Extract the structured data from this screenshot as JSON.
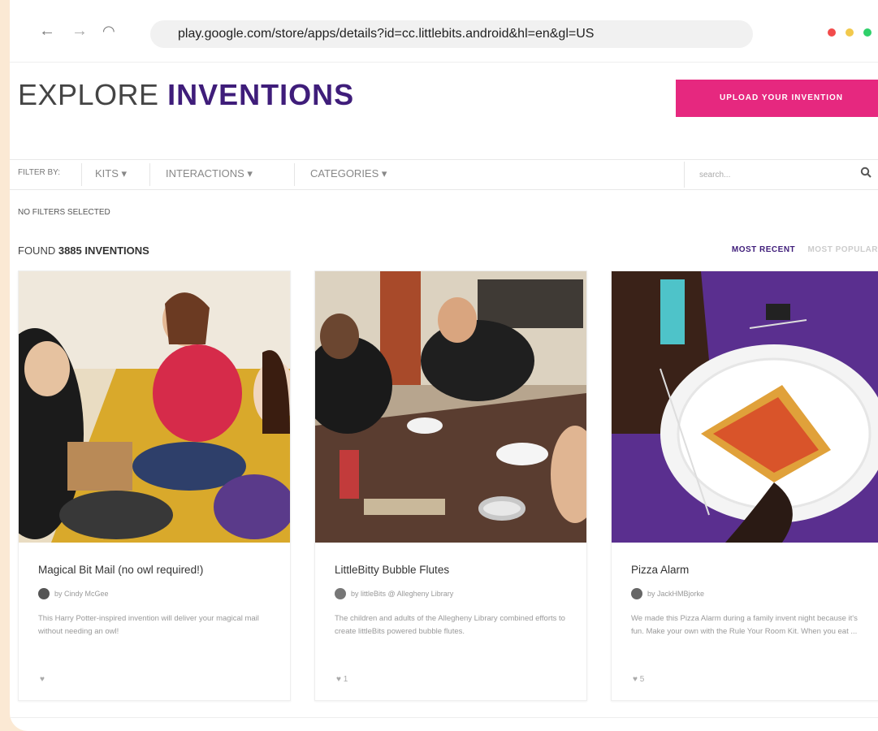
{
  "browser": {
    "url": "play.google.com/store/apps/details?id=cc.littlebits.android&hl=en&gl=US",
    "back_icon": "←",
    "forward_icon": "→",
    "reload_icon": "◠",
    "dot_colors": [
      "#f24b4b",
      "#f2c94c",
      "#2fd06a"
    ]
  },
  "header": {
    "title_light": "EXPLORE",
    "title_bold": "INVENTIONS",
    "upload_label": "UPLOAD YOUR INVENTION",
    "accent": "#e6287f",
    "brand_purple": "#3f1d7a"
  },
  "filters": {
    "label": "FILTER BY:",
    "items": [
      {
        "label": "KITS ▾"
      },
      {
        "label": "INTERACTIONS ▾"
      },
      {
        "label": "CATEGORIES ▾"
      }
    ],
    "search_placeholder": "search...",
    "no_filters": "NO FILTERS SELECTED"
  },
  "results": {
    "found_prefix": "FOUND",
    "count": "3885",
    "found_suffix": "INVENTIONS",
    "sort_active": "MOST RECENT",
    "sort_inactive": "MOST POPULAR"
  },
  "cards": [
    {
      "title": "Magical Bit Mail (no owl required!)",
      "author": "by Cindy McGee",
      "desc": "This Harry Potter-inspired invention will deliver your magical mail without needing an owl!",
      "likes": "♥"
    },
    {
      "title": "LittleBitty Bubble Flutes",
      "author": "by littleBits @ Allegheny Library",
      "desc": "The children and adults of the Allegheny Library combined efforts to create littleBits powered bubble flutes.",
      "likes": "♥ 1"
    },
    {
      "title": "Pizza Alarm",
      "author": "by JackHMBjorke",
      "desc": "We made this Pizza Alarm during a family invent night because it's fun. Make your own with the Rule Your Room Kit. When you eat ...",
      "likes": "♥ 5"
    }
  ]
}
